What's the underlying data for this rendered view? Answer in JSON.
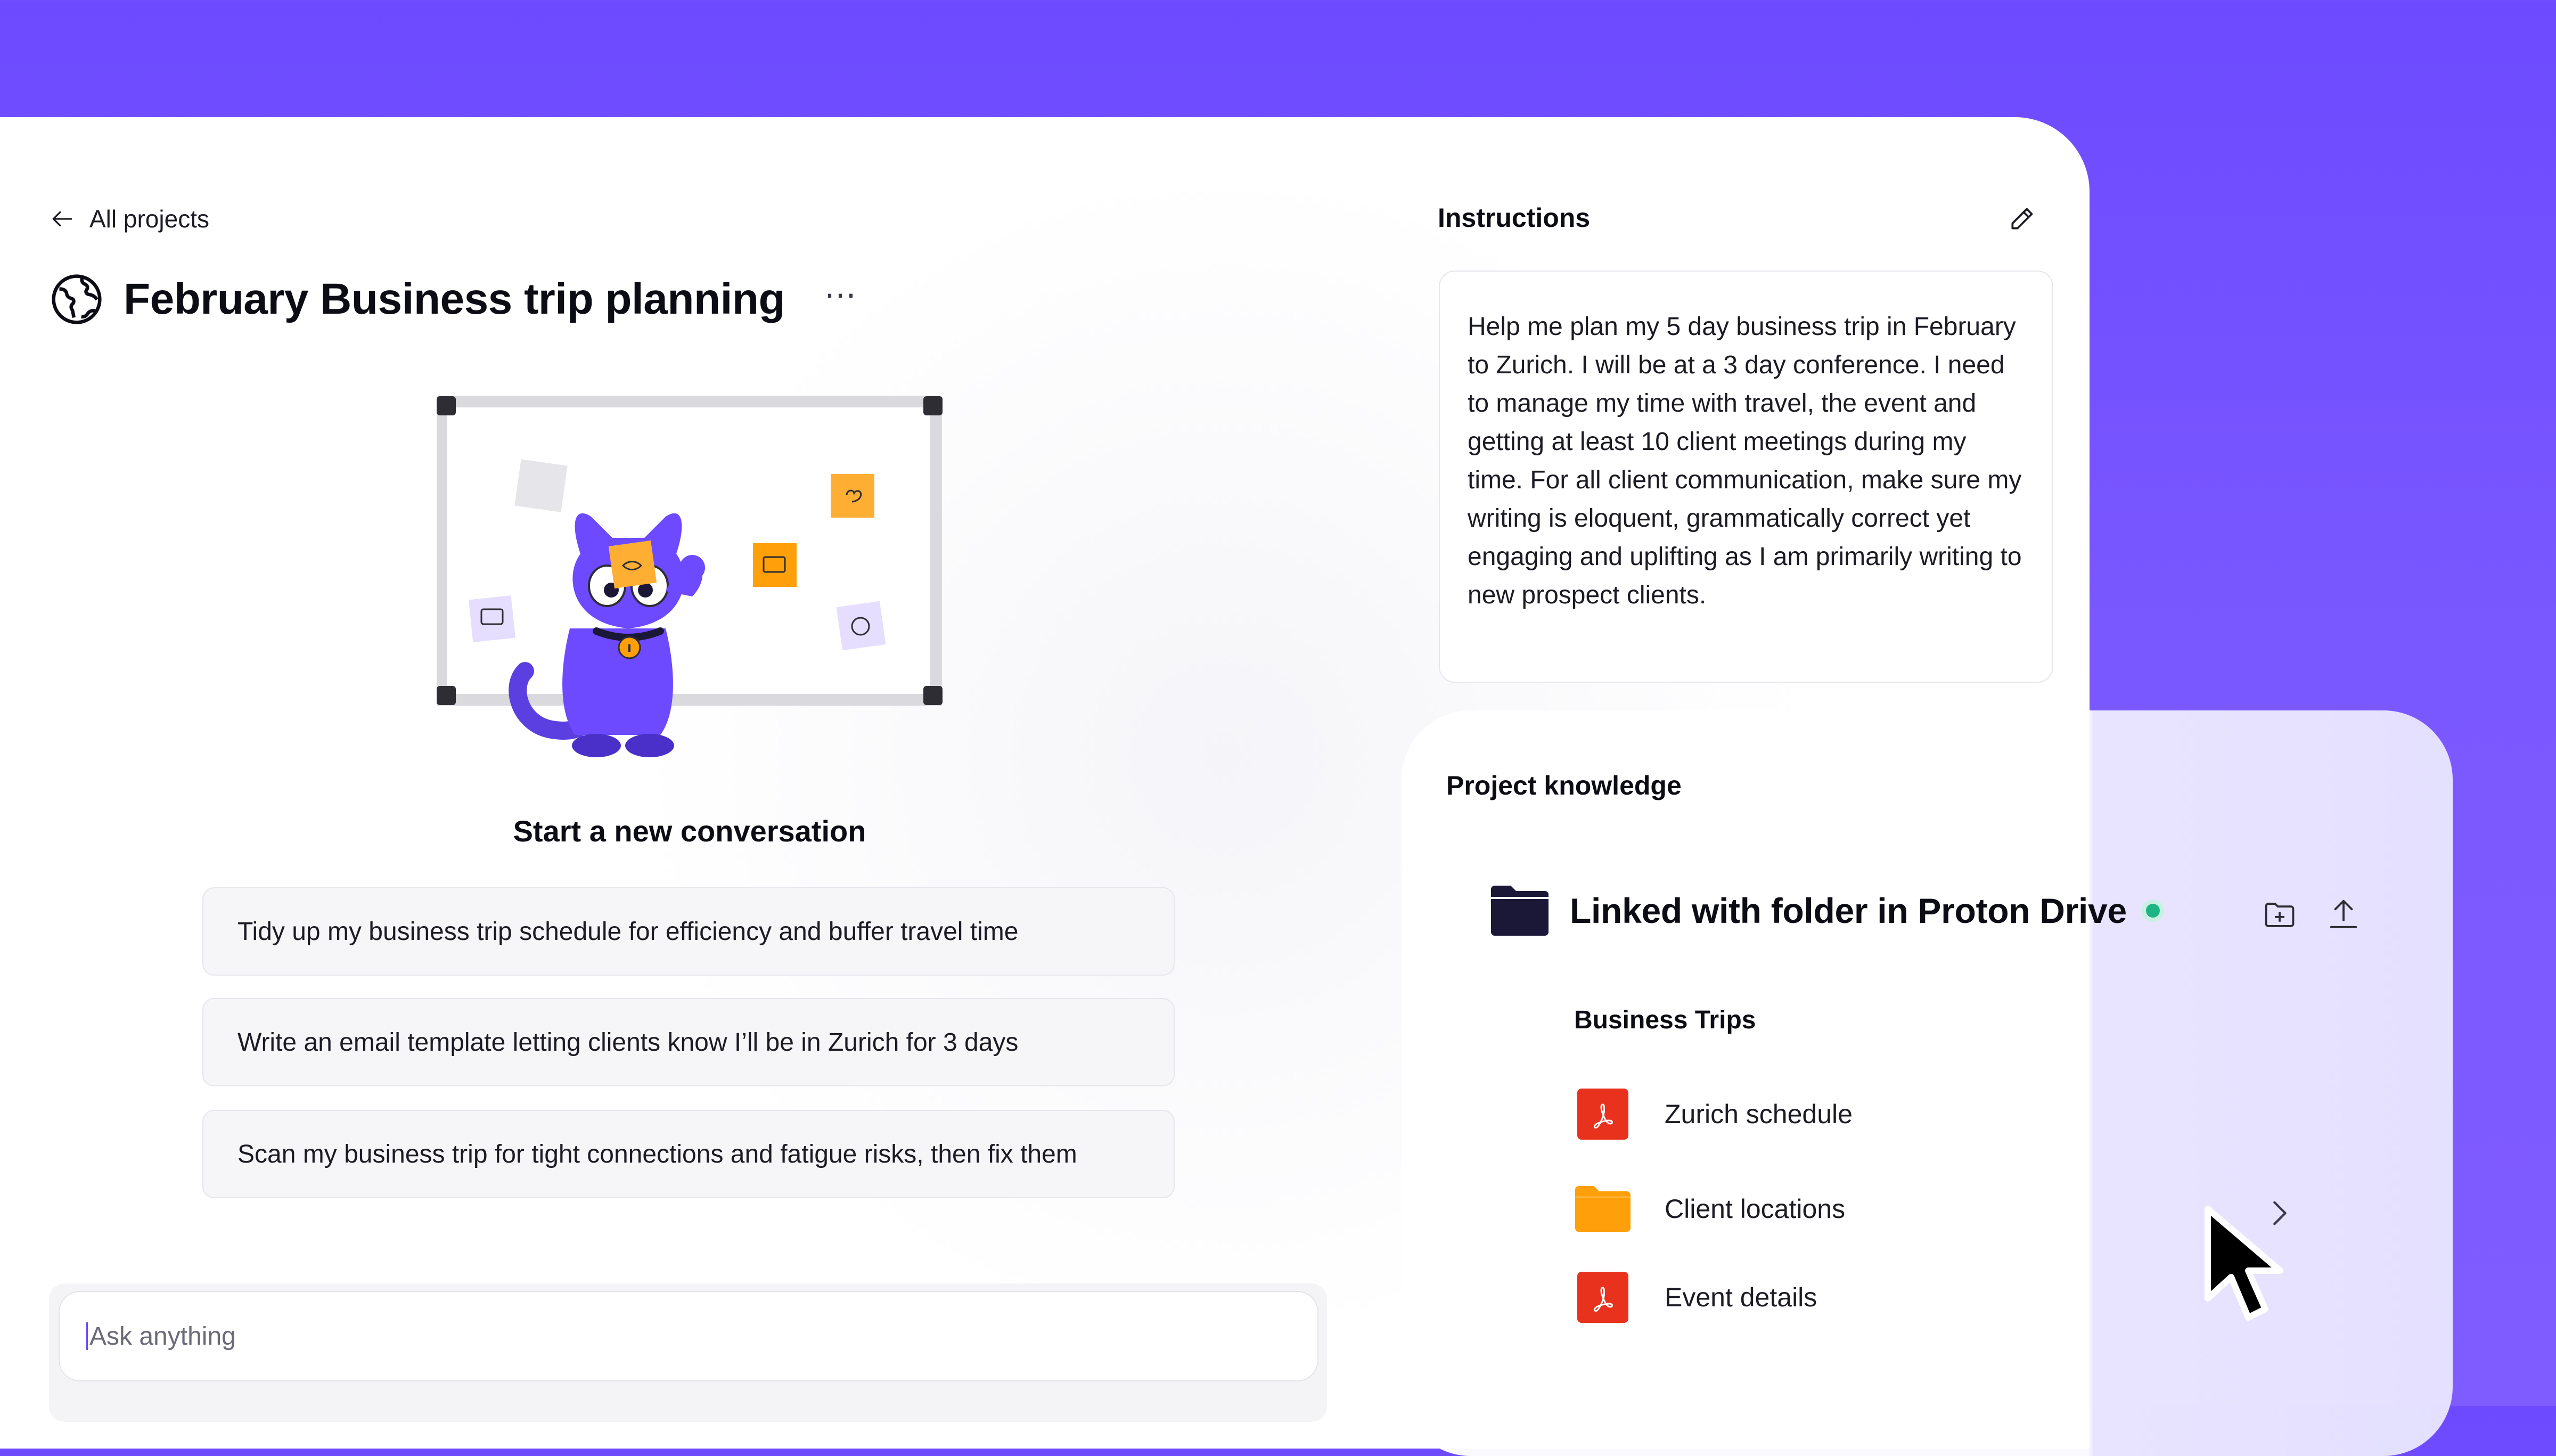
{
  "colors": {
    "brand": "#6d4aff",
    "pdf": "#e8321e",
    "folder": "#ff9f0a",
    "linked_folder": "#1b1737",
    "status_online": "#1db584"
  },
  "nav": {
    "back_label": "All projects",
    "back_icon": "arrow-left-icon"
  },
  "project": {
    "title": "February Business trip planning",
    "icon": "globe-icon",
    "more_label": "⋯"
  },
  "conversation": {
    "start_title": "Start a new conversation",
    "suggestions": [
      "Tidy up my business trip schedule for efficiency and buffer travel time",
      "Write an email template letting clients know I’ll be in Zurich for 3 days",
      "Scan my business trip for tight connections and fatigue risks, then fix them"
    ]
  },
  "composer": {
    "placeholder": "Ask anything"
  },
  "instructions": {
    "label": "Instructions",
    "edit_icon": "pencil-icon",
    "text": "Help me plan my 5 day business trip in February to Zurich. I will be at a 3 day conference. I need to manage my time with travel, the event and getting at least 10 client meetings during my time. For all client communication, make sure my writing is eloquent, grammatically correct yet engaging and uplifting as I am primarily writing to new prospect clients."
  },
  "knowledge": {
    "label": "Project knowledge",
    "linked_title": "Linked with folder in Proton Drive",
    "folder_name": "Business Trips",
    "files": [
      {
        "name": "Zurich schedule",
        "type": "pdf",
        "icon": "pdf-icon"
      },
      {
        "name": "Client locations",
        "type": "folder",
        "icon": "folder-icon"
      },
      {
        "name": "Event details",
        "type": "pdf",
        "icon": "pdf-icon"
      }
    ]
  }
}
